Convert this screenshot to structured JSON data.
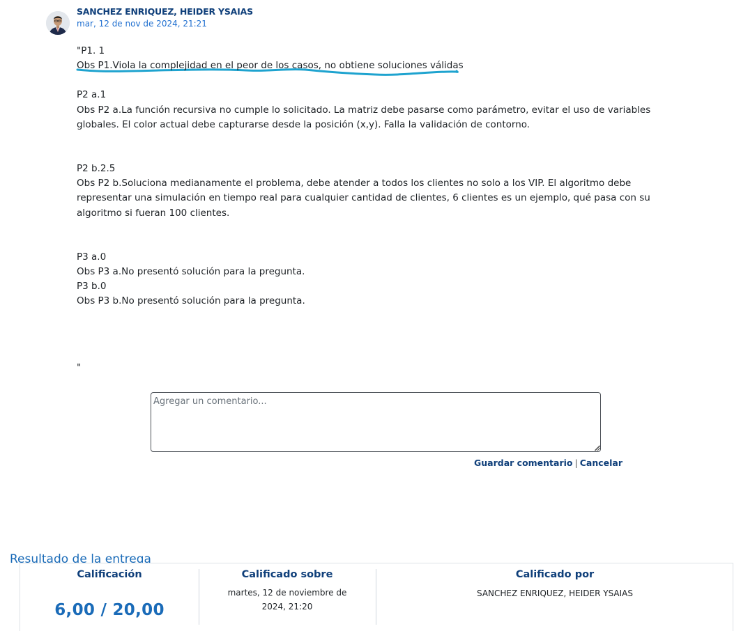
{
  "comment": {
    "author": "SANCHEZ ENRIQUEZ, HEIDER YSAIAS",
    "date": "mar, 12 de nov de 2024, 21:21",
    "body": {
      "p1_title": "\"P1. 1",
      "p1_obs": "Obs P1.Viola la complejidad en el peor de los casos, no obtiene soluciones válidas",
      "p2a_title": "P2 a.1",
      "p2a_obs": "Obs P2 a.La función recursiva no cumple lo solicitado. La matriz debe pasarse como parámetro, evitar el uso de variables globales. El color actual debe capturarse desde la posición (x,y). Falla la validación de contorno.",
      "p2b_title": "P2 b.2.5",
      "p2b_obs": "Obs P2 b.Soluciona medianamente el problema, debe atender a todos los clientes no solo a los VIP. El algoritmo debe representar una simulación en tiempo real para cualquier cantidad de clientes, 6 clientes es un ejemplo, qué pasa con su algoritmo si fueran 100 clientes.",
      "p3a_title": "P3 a.0",
      "p3a_obs": "Obs P3 a.No presentó solución para la pregunta.",
      "p3b_title": "P3 b.0",
      "p3b_obs": "Obs P3 b.No presentó solución para la pregunta.",
      "closing_quote": "\""
    },
    "annotation_color": "#1ea3cf"
  },
  "comment_form": {
    "placeholder": "Agregar un comentario...",
    "save_label": "Guardar comentario",
    "separator": "|",
    "cancel_label": "Cancelar"
  },
  "submission_result": {
    "section_title": "Resultado de la entrega",
    "grade_label": "Calificación",
    "grade_value": "6,00 / 20,00",
    "graded_on_label": "Calificado sobre",
    "graded_on_value": "martes, 12 de noviembre de 2024, 21:20",
    "graded_by_label": "Calificado por",
    "graded_by_value": "SANCHEZ ENRIQUEZ, HEIDER YSAIAS"
  },
  "colors": {
    "accent": "#1a6bb8",
    "link_dark": "#0f3f7a",
    "date_link": "#1f6fd0"
  }
}
